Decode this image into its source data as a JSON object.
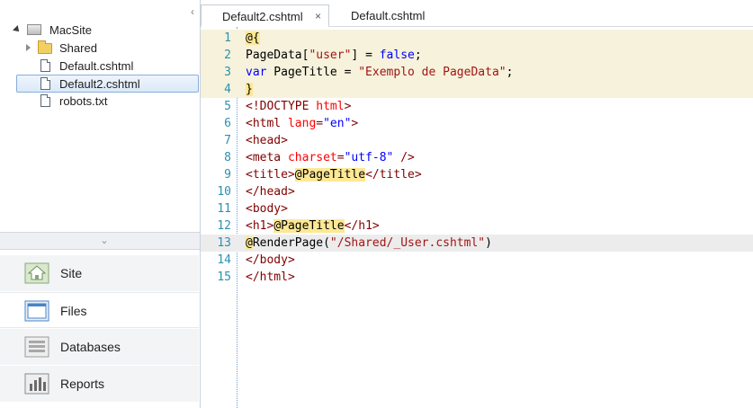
{
  "tree": {
    "root": "MacSite",
    "items": [
      "Shared",
      "Default.cshtml",
      "Default2.cshtml",
      "robots.txt"
    ],
    "selected": "Default2.cshtml"
  },
  "workspace": {
    "items": [
      {
        "label": "Site",
        "icon": "site-icon"
      },
      {
        "label": "Files",
        "icon": "files-icon",
        "active": true
      },
      {
        "label": "Databases",
        "icon": "databases-icon"
      },
      {
        "label": "Reports",
        "icon": "reports-icon"
      }
    ]
  },
  "tabs": [
    {
      "label": "Default2.cshtml",
      "close": "×",
      "active": true
    },
    {
      "label": "Default.cshtml",
      "active": false
    }
  ],
  "editor": {
    "line_numbers": [
      "1",
      "2",
      "3",
      "4",
      "5",
      "6",
      "7",
      "8",
      "9",
      "10",
      "11",
      "12",
      "13",
      "14",
      "15"
    ],
    "current_line": "13",
    "lines": [
      [
        {
          "t": "@{",
          "c": "at"
        }
      ],
      [
        {
          "t": "PageData[",
          "c": "plain"
        },
        {
          "t": "\"user\"",
          "c": "str"
        },
        {
          "t": "] = ",
          "c": "plain"
        },
        {
          "t": "false",
          "c": "kw"
        },
        {
          "t": ";",
          "c": "plain"
        }
      ],
      [
        {
          "t": "var",
          "c": "kw"
        },
        {
          "t": " PageTitle = ",
          "c": "plain"
        },
        {
          "t": "\"Exemplo de PageData\"",
          "c": "str"
        },
        {
          "t": ";",
          "c": "plain"
        }
      ],
      [
        {
          "t": "}",
          "c": "at"
        }
      ],
      [
        {
          "t": "<!DOCTYPE ",
          "c": "tag"
        },
        {
          "t": "html",
          "c": "attr"
        },
        {
          "t": ">",
          "c": "tag"
        }
      ],
      [
        {
          "t": "<html ",
          "c": "tag"
        },
        {
          "t": "lang",
          "c": "attr"
        },
        {
          "t": "=",
          "c": "tag"
        },
        {
          "t": "\"en\"",
          "c": "attrval"
        },
        {
          "t": ">",
          "c": "tag"
        }
      ],
      [
        {
          "t": "<head>",
          "c": "tag"
        }
      ],
      [
        {
          "t": "<meta ",
          "c": "tag"
        },
        {
          "t": "charset",
          "c": "attr"
        },
        {
          "t": "=",
          "c": "tag"
        },
        {
          "t": "\"utf-8\"",
          "c": "attrval"
        },
        {
          "t": " />",
          "c": "tag"
        }
      ],
      [
        {
          "t": "<title>",
          "c": "tag"
        },
        {
          "t": "@",
          "c": "at"
        },
        {
          "t": "PageTitle",
          "c": "at"
        },
        {
          "t": "</title>",
          "c": "tag"
        }
      ],
      [
        {
          "t": "</head>",
          "c": "tag"
        }
      ],
      [
        {
          "t": "<body>",
          "c": "tag"
        }
      ],
      [
        {
          "t": "<h1>",
          "c": "tag"
        },
        {
          "t": "@",
          "c": "at"
        },
        {
          "t": "PageTitle",
          "c": "at"
        },
        {
          "t": "</h1>",
          "c": "tag"
        }
      ],
      [
        {
          "t": "@",
          "c": "at"
        },
        {
          "t": "RenderPage(",
          "c": "plain"
        },
        {
          "t": "\"/Shared/_User.cshtml\"",
          "c": "str"
        },
        {
          "t": ")",
          "c": "plain"
        }
      ],
      [
        {
          "t": "</body>",
          "c": "tag"
        }
      ],
      [
        {
          "t": "</html>",
          "c": "tag"
        }
      ]
    ]
  },
  "colors": {
    "accent": "#86aedb",
    "razor_block": "#f6f2dc",
    "razor_marker": "#fde895",
    "line_number": "#2b91af",
    "string": "#a31515",
    "keyword": "#0000ff",
    "tag": "#800000",
    "attribute": "#ff0000"
  }
}
